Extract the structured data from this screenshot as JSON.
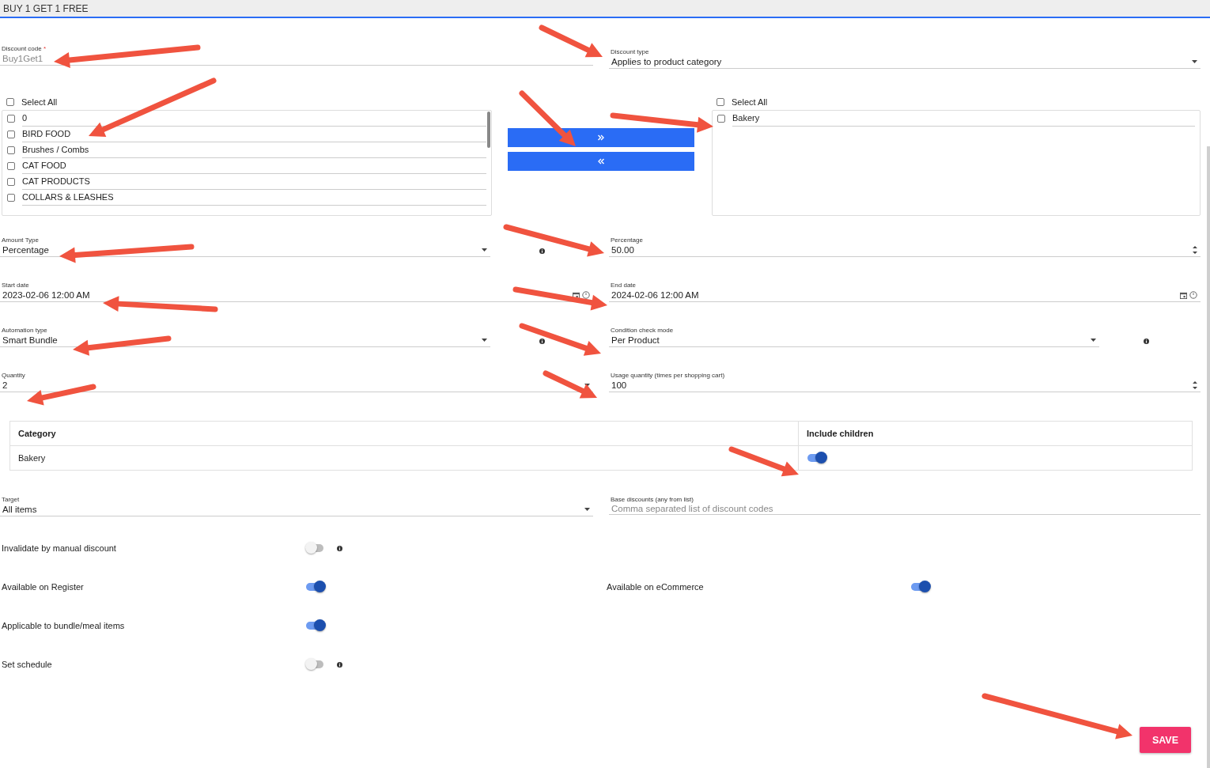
{
  "header": {
    "title": "BUY 1 GET 1 FREE"
  },
  "discount_code": {
    "label": "Discount code",
    "required_mark": "*",
    "value": "Buy1Get1",
    "disabled": true
  },
  "discount_type": {
    "kind": "select",
    "label": "Discount type",
    "value": "Applies to product category"
  },
  "available_list": {
    "select_all": {
      "label": "Select All",
      "checked": false
    },
    "items": [
      {
        "label": "0",
        "checked": false
      },
      {
        "label": "BIRD FOOD",
        "checked": false
      },
      {
        "label": "Brushes / Combs",
        "checked": false
      },
      {
        "label": "CAT FOOD",
        "checked": false
      },
      {
        "label": "CAT PRODUCTS",
        "checked": false
      },
      {
        "label": "COLLARS & LEASHES",
        "checked": false
      }
    ]
  },
  "selected_list": {
    "select_all": {
      "label": "Select All",
      "checked": false
    },
    "items": [
      {
        "label": "Bakery",
        "checked": false
      }
    ]
  },
  "field_rows": [
    [
      {
        "kind": "select",
        "label": "Amount Type",
        "value": "Percentage",
        "info": true
      },
      {
        "kind": "number",
        "label": "Percentage",
        "value": "50.00"
      }
    ],
    [
      {
        "kind": "datetime",
        "label": "Start date",
        "value": "2023-02-06 12:00 AM"
      },
      {
        "kind": "datetime",
        "label": "End date",
        "value": "2024-02-06 12:00 AM"
      }
    ],
    [
      {
        "kind": "select",
        "label": "Automation type",
        "value": "Smart Bundle",
        "info": true
      },
      {
        "kind": "select",
        "label": "Condition check mode",
        "value": "Per Product",
        "info": true
      }
    ],
    [
      {
        "kind": "caret",
        "label": "Quantity",
        "value": "2"
      },
      {
        "kind": "number",
        "label": "Usage quantity (times per shopping cart)",
        "value": "100"
      }
    ]
  ],
  "table": {
    "columns": [
      "Category",
      "Include children"
    ],
    "rows": [
      {
        "category": "Bakery",
        "include_children": true
      }
    ]
  },
  "target": {
    "kind": "select",
    "label": "Target",
    "value": "All items"
  },
  "base_discounts": {
    "kind": "text",
    "label": "Base discounts (any from list)",
    "placeholder": "Comma separated list of discount codes"
  },
  "toggle_rows": [
    [
      {
        "label": "Invalidate by manual discount",
        "on": false,
        "info": true
      }
    ],
    [
      {
        "label": "Available on Register",
        "on": true
      },
      {
        "label": "Available on eCommerce",
        "on": true
      }
    ],
    [
      {
        "label": "Applicable to bundle/meal items",
        "on": true
      }
    ],
    [
      {
        "label": "Set schedule",
        "on": false,
        "info": true
      }
    ]
  ],
  "save_button": {
    "label": "SAVE"
  }
}
